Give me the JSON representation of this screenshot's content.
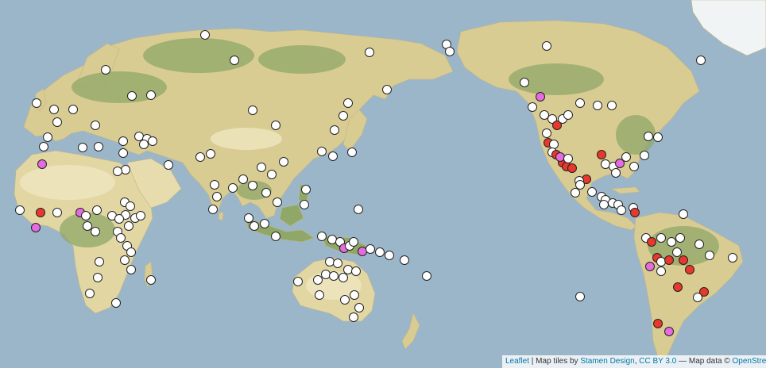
{
  "map": {
    "colors": {
      "ocean": "#9cb6c9",
      "land": "#d9cc92",
      "forest": "#8fa868",
      "desert": "#e6dcae",
      "ice": "#f1f4f4",
      "marker_white": "#ffffff",
      "marker_red": "#e8372c",
      "marker_pink": "#e56be0",
      "marker_stroke": "#222222"
    },
    "legend": null
  },
  "attribution": {
    "leaflet": "Leaflet",
    "sep1": " | Map tiles by ",
    "stamen": "Stamen Design",
    "sep2": ", ",
    "license": "CC BY 3.0",
    "sep3": " — Map data © ",
    "osm": "OpenStreetMap"
  }
}
